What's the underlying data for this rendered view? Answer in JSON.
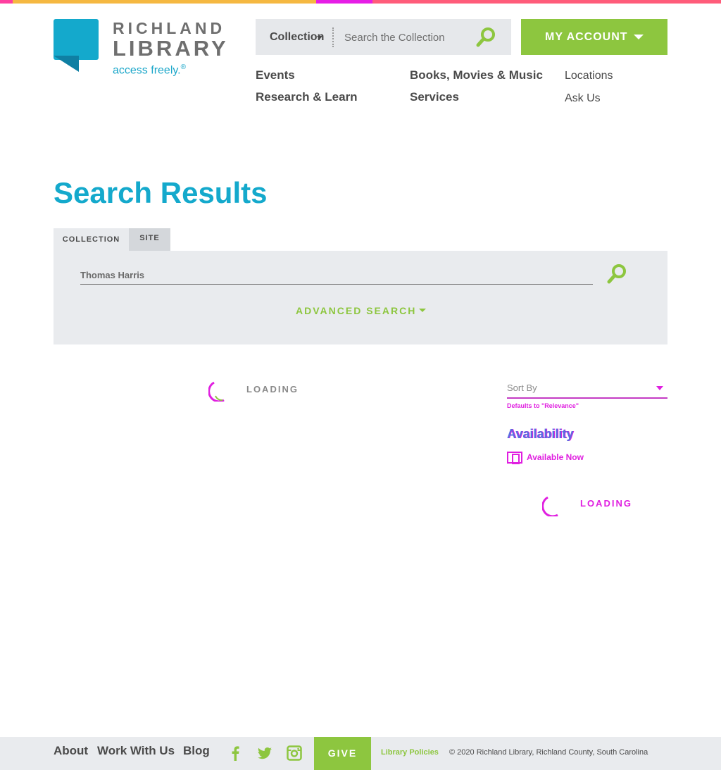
{
  "colors": {
    "brand_blue": "#14a9cc",
    "brand_green": "#8dc63f",
    "panel_gray": "#e9ebee",
    "text_gray": "#4a4a4a",
    "debug_magenta": "#e01fe0"
  },
  "logo": {
    "word1": "RICHLAND",
    "word2": "LIBRARY",
    "tagline": "access freely.",
    "tagline_mark": "®"
  },
  "header": {
    "search_scope": "Collection",
    "search_placeholder": "Search the Collection",
    "search_icon": "magnifier-icon",
    "account_label": "MY ACCOUNT"
  },
  "nav": {
    "events": "Events",
    "books": "Books, Movies & Music",
    "locations": "Locations",
    "research": "Research & Learn",
    "services": "Services",
    "ask": "Ask Us"
  },
  "page": {
    "title": "Search Results"
  },
  "tabs": {
    "collection": "COLLECTION",
    "site": "SITE"
  },
  "search_panel": {
    "query": "Thomas Harris",
    "advanced": "ADVANCED SEARCH"
  },
  "results": {
    "loading": "LOADING"
  },
  "sidebar": {
    "sort_label": "Sort By",
    "sort_note": "Defaults to \"Relevance\"",
    "facet_title": "Availability",
    "facet_option": "Available Now",
    "loading": "LOADING"
  },
  "footer": {
    "about": "About",
    "work": "Work With Us",
    "blog": "Blog",
    "give": "GIVE",
    "policies": "Library Policies",
    "copyright": "© 2020 Richland Library, Richland County, South Carolina",
    "social": [
      "facebook-icon",
      "twitter-icon",
      "instagram-icon"
    ]
  }
}
